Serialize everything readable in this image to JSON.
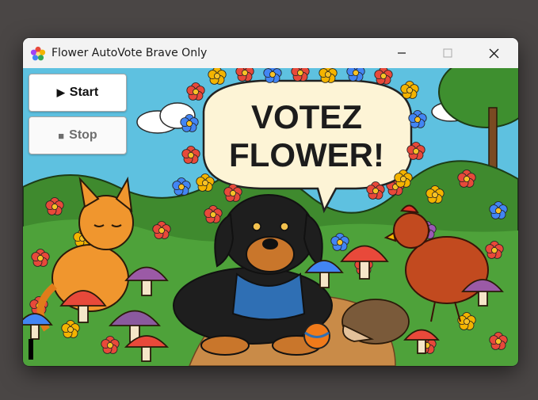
{
  "window": {
    "title": "Flower AutoVote Brave Only",
    "controls": {
      "minimize": "minimize-icon",
      "maximize": "maximize-icon",
      "close": "close-icon"
    }
  },
  "buttons": {
    "start": {
      "glyph": "▶",
      "label": "Start"
    },
    "stop": {
      "glyph": "■",
      "label": "Stop"
    }
  },
  "poster": {
    "headline_line1": "VOTEZ",
    "headline_line2": "FLOWER!"
  },
  "colors": {
    "sky": "#5ec1e0",
    "grass": "#3f8a2e",
    "speech_bubble": "#fdf4d6",
    "accent_text": "#1c1c1c"
  }
}
